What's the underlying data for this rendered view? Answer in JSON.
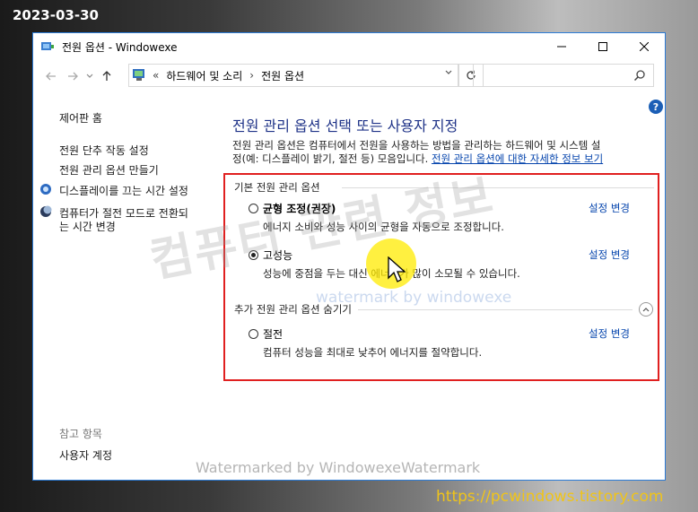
{
  "stamps": {
    "date": "2023-03-30",
    "url": "https://pcwindows.tistory.com"
  },
  "window": {
    "title": "전원 옵션   - Windowexe",
    "controls": {
      "minimize": "minimize-icon",
      "maximize": "maximize-icon",
      "close": "close-icon"
    }
  },
  "address": {
    "overflow": "«",
    "crumbs": [
      "하드웨어 및 소리",
      "전원 옵션"
    ],
    "separator": "›"
  },
  "search": {
    "placeholder": ""
  },
  "sidebar": {
    "home": "제어판 홈",
    "items": [
      "전원 단추 작동 설정",
      "전원 관리 옵션 만들기",
      "디스플레이를 끄는 시간 설정",
      "컴퓨터가 절전 모드로 전환되",
      "는 시간 변경"
    ],
    "see_also_label": "참고 항목",
    "see_also_items": [
      "사용자 계정"
    ]
  },
  "main": {
    "title": "전원 관리 옵션 선택 또는 사용자 지정",
    "description_line1": "전원 관리 옵션은 컴퓨터에서 전원을 사용하는 방법을 관리하는 하드웨어 및 시스템 설",
    "description_line2": "정(예: 디스플레이 밝기, 절전 등) 모음입니다.",
    "description_link": "전원 관리 옵션에 대한 자세한 정보 보기",
    "group_basic": "기본 전원 관리 옵션",
    "group_extra": "추가 전원 관리 옵션 숨기기",
    "change_label": "설정 변경",
    "plans": [
      {
        "name": "균형 조정(권장)",
        "desc": "에너지 소비와 성능 사이의 균형을 자동으로 조정합니다.",
        "checked": false
      },
      {
        "name": "고성능",
        "desc": "성능에 중점을 두는 대신 에너지가 많이 소모될 수 있습니다.",
        "checked": true
      },
      {
        "name": "절전",
        "desc": "컴퓨터 성능을 최대로 낮추어 에너지를 절약합니다.",
        "checked": false
      }
    ]
  },
  "watermarks": {
    "big": "컴퓨터 관련 정보",
    "small": "watermark by windowexe",
    "bottom": "Watermarked by WindowexeWatermark"
  },
  "colors": {
    "accent": "#2b7bd6",
    "link": "#0645ad",
    "title": "#1e3287",
    "highlight": "#e02020"
  }
}
